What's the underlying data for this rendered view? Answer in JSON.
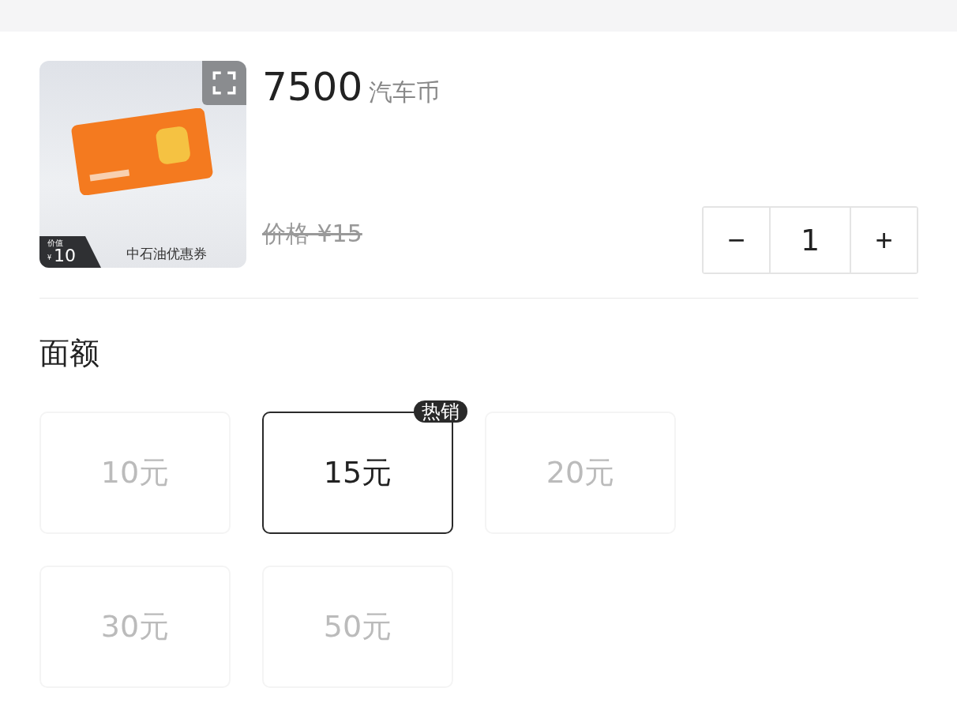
{
  "product": {
    "value_label": "价值",
    "value_currency": "¥",
    "value_amount": "10",
    "image_caption": "中石油优惠券",
    "price_amount": "7500",
    "price_unit": "汽车币",
    "original_price": "价格 ¥15",
    "quantity": "1",
    "minus": "−",
    "plus": "+"
  },
  "denomination": {
    "title": "面额",
    "options": [
      {
        "label": "10元",
        "selected": false
      },
      {
        "label": "15元",
        "selected": true,
        "badge": "热销"
      },
      {
        "label": "20元",
        "selected": false
      },
      {
        "label": "30元",
        "selected": false
      },
      {
        "label": "50元",
        "selected": false
      }
    ]
  }
}
